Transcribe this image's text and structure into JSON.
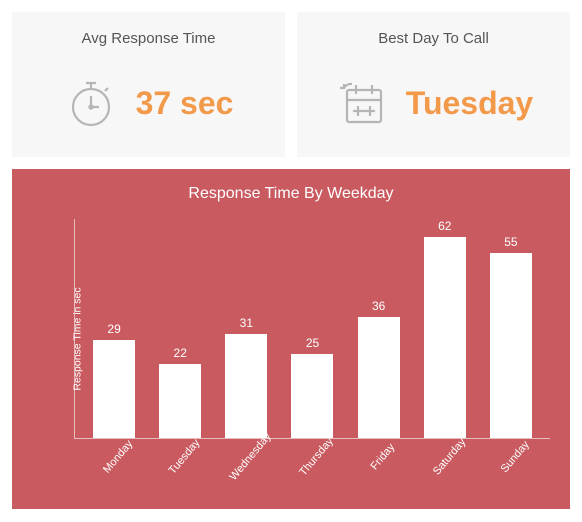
{
  "cards": {
    "avg_response": {
      "title": "Avg Response Time",
      "value": "37 sec"
    },
    "best_day": {
      "title": "Best Day To Call",
      "value": "Tuesday"
    }
  },
  "chart_data": {
    "type": "bar",
    "title": "Response Time By Weekday",
    "ylabel": "Response Time in sec",
    "xlabel": "",
    "ylim": [
      0,
      65
    ],
    "categories": [
      "Monday",
      "Tuesday",
      "Wednesday",
      "Thursday",
      "Friday",
      "Saturday",
      "Sunday"
    ],
    "values": [
      29,
      22,
      31,
      25,
      36,
      62,
      55
    ]
  },
  "colors": {
    "accent": "#f2994a",
    "panel": "#c95a60",
    "icon": "#b5b5b5"
  }
}
